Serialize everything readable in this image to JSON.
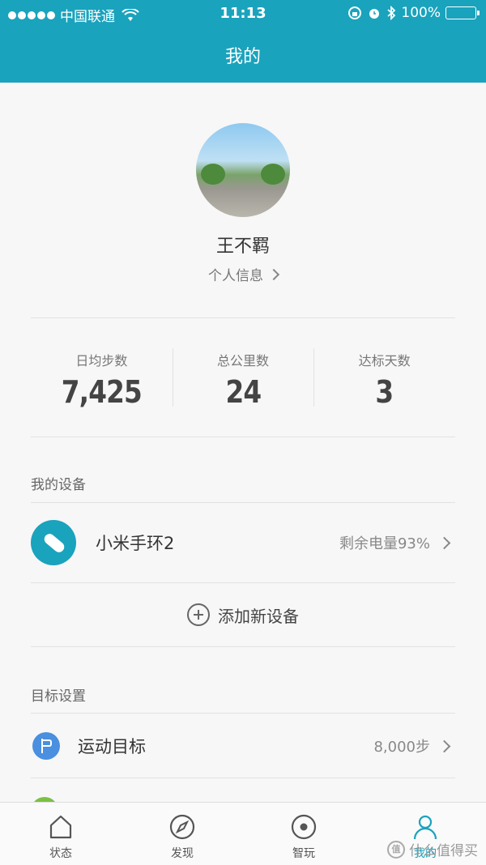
{
  "status_bar": {
    "carrier": "中国联通",
    "time": "11:13",
    "battery": "100%"
  },
  "page_title": "我的",
  "profile": {
    "name": "王不羁",
    "link_label": "个人信息"
  },
  "stats": [
    {
      "label": "日均步数",
      "value": "7,425"
    },
    {
      "label": "总公里数",
      "value": "24"
    },
    {
      "label": "达标天数",
      "value": "3"
    }
  ],
  "devices": {
    "section_title": "我的设备",
    "items": [
      {
        "name": "小米手环2",
        "status": "剩余电量93%"
      }
    ],
    "add_label": "添加新设备"
  },
  "goals": {
    "section_title": "目标设置",
    "items": [
      {
        "name": "运动目标",
        "value": "8,000步"
      }
    ]
  },
  "tabbar": {
    "items": [
      {
        "label": "状态",
        "icon": "home-icon"
      },
      {
        "label": "发现",
        "icon": "compass-icon"
      },
      {
        "label": "智玩",
        "icon": "target-icon"
      },
      {
        "label": "我的",
        "icon": "profile-icon",
        "active": true
      }
    ]
  },
  "watermark": {
    "text": "什么值得买",
    "badge": "值"
  },
  "colors": {
    "accent": "#1aa3bd",
    "goal_icon": "#4a8fe0",
    "background": "#f7f7f7"
  }
}
